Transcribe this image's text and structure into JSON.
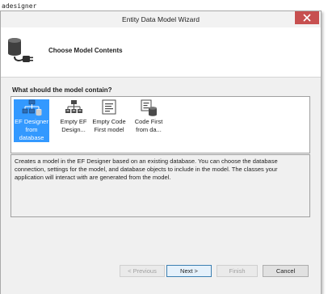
{
  "background": {
    "text": "adesigner"
  },
  "window": {
    "title": "Entity Data Model Wizard"
  },
  "header": {
    "title": "Choose Model Contents",
    "icon": "database-plug-icon"
  },
  "main": {
    "question": "What should the model contain?",
    "options": [
      {
        "label_lines": [
          "EF Designer",
          "from",
          "database"
        ],
        "icon": "ef-designer-database-icon",
        "selected": true
      },
      {
        "label_lines": [
          "Empty EF",
          "Design..."
        ],
        "icon": "empty-ef-designer-icon",
        "selected": false
      },
      {
        "label_lines": [
          "Empty Code",
          "First model"
        ],
        "icon": "empty-code-first-icon",
        "selected": false
      },
      {
        "label_lines": [
          "Code First",
          "from da..."
        ],
        "icon": "code-first-database-icon",
        "selected": false
      }
    ],
    "description": "Creates a model in the EF Designer based on an existing database. You can choose the database connection, settings for the model, and database objects to include in the model. The classes your application will interact with are generated from the model."
  },
  "footer": {
    "previous": "< Previous",
    "next": "Next >",
    "finish": "Finish",
    "cancel": "Cancel"
  },
  "colors": {
    "selection": "#3399ff",
    "close_button": "#c75050"
  }
}
